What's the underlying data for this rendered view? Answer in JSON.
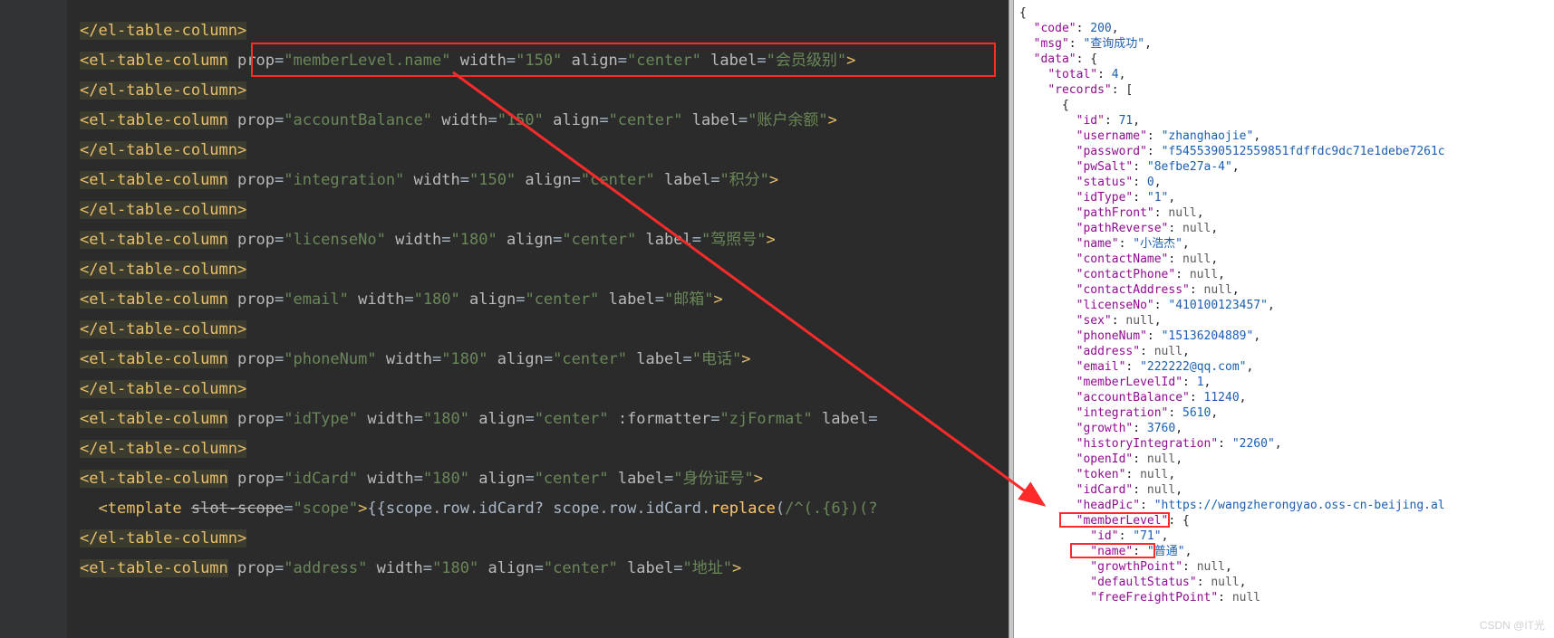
{
  "watermark": "CSDN @IT光",
  "left": {
    "lines": [
      {
        "indent": 0,
        "type": "close",
        "tag": "el-table-column"
      },
      {
        "indent": 0,
        "type": "open",
        "tag": "el-table-column",
        "attrs": [
          [
            "prop",
            "memberLevel.name"
          ],
          [
            "width",
            "150"
          ],
          [
            "align",
            "center"
          ],
          [
            "label",
            "会员级别"
          ]
        ],
        "boxed": true
      },
      {
        "indent": 0,
        "type": "close",
        "tag": "el-table-column"
      },
      {
        "indent": 0,
        "type": "open",
        "tag": "el-table-column",
        "attrs": [
          [
            "prop",
            "accountBalance"
          ],
          [
            "width",
            "150"
          ],
          [
            "align",
            "center"
          ],
          [
            "label",
            "账户余额"
          ]
        ]
      },
      {
        "indent": 0,
        "type": "close",
        "tag": "el-table-column"
      },
      {
        "indent": 0,
        "type": "open",
        "tag": "el-table-column",
        "attrs": [
          [
            "prop",
            "integration"
          ],
          [
            "width",
            "150"
          ],
          [
            "align",
            "center"
          ],
          [
            "label",
            "积分"
          ]
        ]
      },
      {
        "indent": 0,
        "type": "close",
        "tag": "el-table-column"
      },
      {
        "indent": 0,
        "type": "open",
        "tag": "el-table-column",
        "attrs": [
          [
            "prop",
            "licenseNo"
          ],
          [
            "width",
            "180"
          ],
          [
            "align",
            "center"
          ],
          [
            "label",
            "驾照号"
          ]
        ]
      },
      {
        "indent": 0,
        "type": "close",
        "tag": "el-table-column"
      },
      {
        "indent": 0,
        "type": "open",
        "tag": "el-table-column",
        "attrs": [
          [
            "prop",
            "email"
          ],
          [
            "width",
            "180"
          ],
          [
            "align",
            "center"
          ],
          [
            "label",
            "邮箱"
          ]
        ]
      },
      {
        "indent": 0,
        "type": "close",
        "tag": "el-table-column"
      },
      {
        "indent": 0,
        "type": "open",
        "tag": "el-table-column",
        "attrs": [
          [
            "prop",
            "phoneNum"
          ],
          [
            "width",
            "180"
          ],
          [
            "align",
            "center"
          ],
          [
            "label",
            "电话"
          ]
        ]
      },
      {
        "indent": 0,
        "type": "close",
        "tag": "el-table-column"
      },
      {
        "indent": 0,
        "type": "open",
        "tag": "el-table-column",
        "attrs": [
          [
            "prop",
            "idType"
          ],
          [
            "width",
            "180"
          ],
          [
            "align",
            "center"
          ],
          [
            ":formatter",
            "zjFormat"
          ],
          [
            "label",
            ""
          ]
        ],
        "truncated": true
      },
      {
        "indent": 0,
        "type": "close",
        "tag": "el-table-column"
      },
      {
        "indent": 0,
        "type": "open",
        "tag": "el-table-column",
        "attrs": [
          [
            "prop",
            "idCard"
          ],
          [
            "width",
            "180"
          ],
          [
            "align",
            "center"
          ],
          [
            "label",
            "身份证号"
          ]
        ]
      },
      {
        "indent": 1,
        "type": "template",
        "tag": "template",
        "slotScope": "scope",
        "content": "{{scope.row.idCard? scope.row.idCard.replace(/^(.{6})(?"
      },
      {
        "indent": 0,
        "type": "close",
        "tag": "el-table-column"
      },
      {
        "indent": 0,
        "type": "open",
        "tag": "el-table-column",
        "attrs": [
          [
            "prop",
            "address"
          ],
          [
            "width",
            "180"
          ],
          [
            "align",
            "center"
          ],
          [
            "label",
            "地址"
          ]
        ]
      }
    ]
  },
  "right": {
    "json": [
      {
        "i": 0,
        "t": "punct",
        "txt": "{"
      },
      {
        "i": 1,
        "kv": [
          "\"code\"",
          "200",
          "num"
        ],
        "comma": true
      },
      {
        "i": 1,
        "kv": [
          "\"msg\"",
          "\"查询成功\"",
          "str"
        ],
        "comma": true
      },
      {
        "i": 1,
        "kv": [
          "\"data\"",
          "{",
          "punct"
        ]
      },
      {
        "i": 2,
        "kv": [
          "\"total\"",
          "4",
          "num"
        ],
        "comma": true
      },
      {
        "i": 2,
        "kv": [
          "\"records\"",
          "[",
          "punct"
        ]
      },
      {
        "i": 3,
        "t": "punct",
        "txt": "{"
      },
      {
        "i": 4,
        "kv": [
          "\"id\"",
          "71",
          "num"
        ],
        "comma": true
      },
      {
        "i": 4,
        "kv": [
          "\"username\"",
          "\"zhanghaojie\"",
          "str"
        ],
        "comma": true
      },
      {
        "i": 4,
        "kv": [
          "\"password\"",
          "\"f5455390512559851fdffdc9dc71e1debe7261c",
          "str"
        ],
        "trunc": true
      },
      {
        "i": 4,
        "kv": [
          "\"pwSalt\"",
          "\"8efbe27a-4\"",
          "str"
        ],
        "comma": true
      },
      {
        "i": 4,
        "kv": [
          "\"status\"",
          "0",
          "num"
        ],
        "comma": true
      },
      {
        "i": 4,
        "kv": [
          "\"idType\"",
          "\"1\"",
          "str"
        ],
        "comma": true
      },
      {
        "i": 4,
        "kv": [
          "\"pathFront\"",
          "null",
          "null"
        ],
        "comma": true
      },
      {
        "i": 4,
        "kv": [
          "\"pathReverse\"",
          "null",
          "null"
        ],
        "comma": true
      },
      {
        "i": 4,
        "kv": [
          "\"name\"",
          "\"小浩杰\"",
          "str"
        ],
        "comma": true
      },
      {
        "i": 4,
        "kv": [
          "\"contactName\"",
          "null",
          "null"
        ],
        "comma": true
      },
      {
        "i": 4,
        "kv": [
          "\"contactPhone\"",
          "null",
          "null"
        ],
        "comma": true
      },
      {
        "i": 4,
        "kv": [
          "\"contactAddress\"",
          "null",
          "null"
        ],
        "comma": true
      },
      {
        "i": 4,
        "kv": [
          "\"licenseNo\"",
          "\"410100123457\"",
          "str"
        ],
        "comma": true
      },
      {
        "i": 4,
        "kv": [
          "\"sex\"",
          "null",
          "null"
        ],
        "comma": true
      },
      {
        "i": 4,
        "kv": [
          "\"phoneNum\"",
          "\"15136204889\"",
          "str"
        ],
        "comma": true
      },
      {
        "i": 4,
        "kv": [
          "\"address\"",
          "null",
          "null"
        ],
        "comma": true
      },
      {
        "i": 4,
        "kv": [
          "\"email\"",
          "\"222222@qq.com\"",
          "str"
        ],
        "comma": true
      },
      {
        "i": 4,
        "kv": [
          "\"memberLevelId\"",
          "1",
          "num"
        ],
        "comma": true
      },
      {
        "i": 4,
        "kv": [
          "\"accountBalance\"",
          "11240",
          "num"
        ],
        "comma": true
      },
      {
        "i": 4,
        "kv": [
          "\"integration\"",
          "5610",
          "num"
        ],
        "comma": true
      },
      {
        "i": 4,
        "kv": [
          "\"growth\"",
          "3760",
          "num"
        ],
        "comma": true
      },
      {
        "i": 4,
        "kv": [
          "\"historyIntegration\"",
          "\"2260\"",
          "str"
        ],
        "comma": true
      },
      {
        "i": 4,
        "kv": [
          "\"openId\"",
          "null",
          "null"
        ],
        "comma": true
      },
      {
        "i": 4,
        "kv": [
          "\"token\"",
          "null",
          "null"
        ],
        "comma": true
      },
      {
        "i": 4,
        "kv": [
          "\"idCard\"",
          "null",
          "null"
        ],
        "comma": true
      },
      {
        "i": 4,
        "kv": [
          "\"headPic\"",
          "\"https://wangzherongyao.oss-cn-beijing.al",
          "str"
        ],
        "trunc": true
      },
      {
        "i": 4,
        "kv": [
          "\"memberLevel\"",
          "{",
          "punct"
        ],
        "boxed": true
      },
      {
        "i": 5,
        "kv": [
          "\"id\"",
          "\"71\"",
          "str"
        ],
        "comma": true
      },
      {
        "i": 5,
        "kv": [
          "\"name\"",
          "\"普通\"",
          "str"
        ],
        "comma": true,
        "boxed": true
      },
      {
        "i": 5,
        "kv": [
          "\"growthPoint\"",
          "null",
          "null"
        ],
        "comma": true
      },
      {
        "i": 5,
        "kv": [
          "\"defaultStatus\"",
          "null",
          "null"
        ],
        "comma": true
      },
      {
        "i": 5,
        "kv": [
          "\"freeFreightPoint\"",
          "null",
          "null"
        ],
        "trunc": true
      }
    ]
  }
}
